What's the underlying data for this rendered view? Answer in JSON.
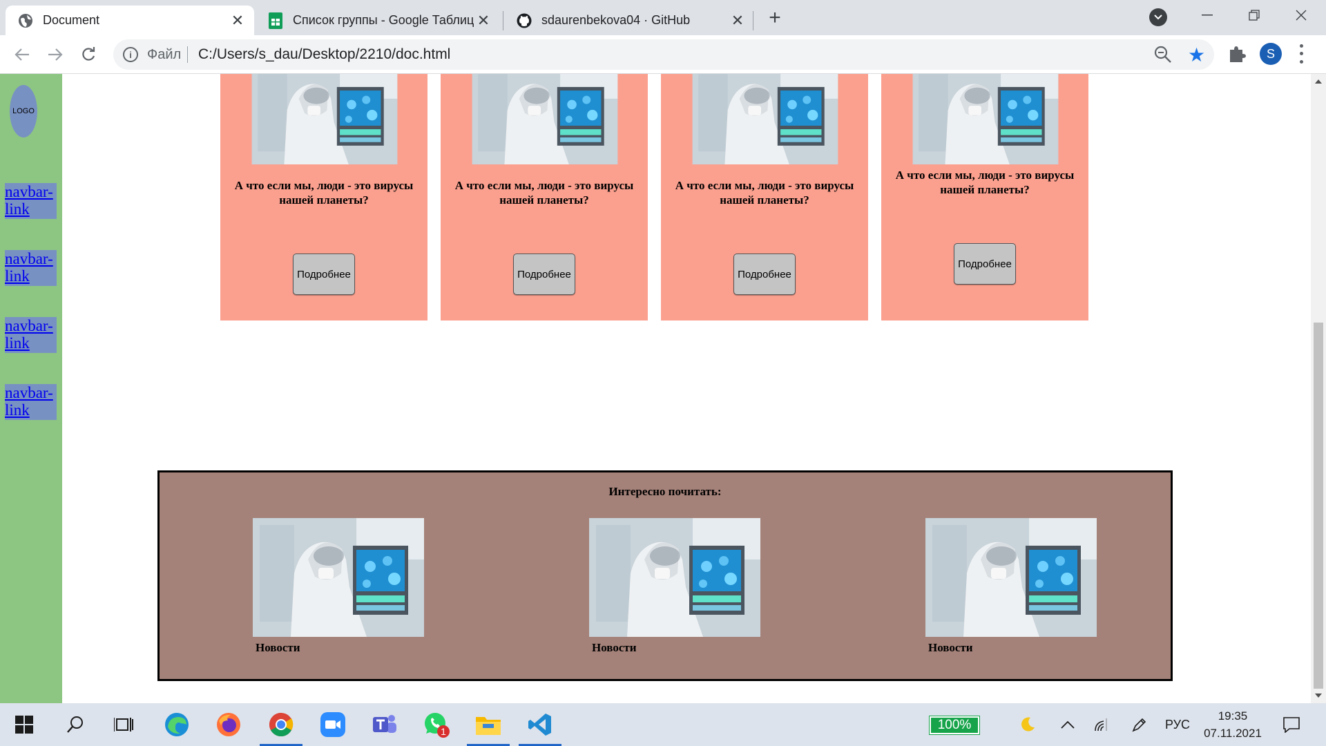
{
  "browser": {
    "tabs": [
      {
        "title": "Document",
        "icon": "globe-icon"
      },
      {
        "title": "Список группы - Google Таблицы",
        "icon": "google-sheets-icon"
      },
      {
        "title": "sdaurenbekova04 · GitHub",
        "icon": "github-icon"
      }
    ],
    "address": {
      "scheme": "Файл",
      "url": "C:/Users/s_dau/Desktop/2210/doc.html"
    },
    "profile_initial": "S"
  },
  "page": {
    "logo": "LOGO",
    "nav_links": [
      "navbar-link",
      "navbar-link",
      "navbar-link",
      "navbar-link"
    ],
    "cards": [
      {
        "title": "А что если мы, люди - это вирусы нашей планеты?",
        "button": "Подробнее"
      },
      {
        "title": "А что если мы, люди - это вирусы нашей планеты?",
        "button": "Подробнее"
      },
      {
        "title": "А что если мы, люди - это вирусы нашей планеты?",
        "button": "Подробнее"
      },
      {
        "title": "А что если мы, люди - это вирусы нашей планеты?",
        "button": "Подробнее"
      }
    ],
    "reading": {
      "title": "Интересно почитать:",
      "items": [
        {
          "label": "Новости"
        },
        {
          "label": "Новости"
        },
        {
          "label": "Новости"
        }
      ]
    }
  },
  "taskbar": {
    "battery": "100%",
    "language": "РУС",
    "time": "19:35",
    "date": "07.11.2021",
    "whatsapp_badge": "1"
  },
  "colors": {
    "sidebar": "#8dc682",
    "card": "#fba08f",
    "reading_block": "#a58279",
    "nav_link_bg": "#7891c3"
  }
}
